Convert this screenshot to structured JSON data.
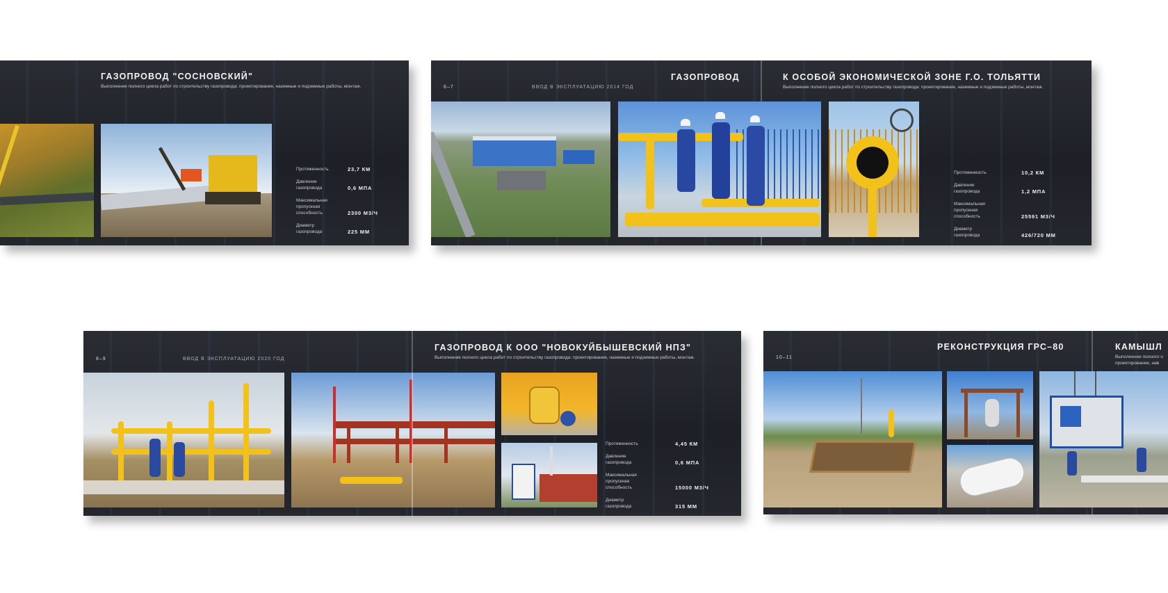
{
  "spreads": {
    "sosnovsky": {
      "title": "ГАЗОПРОВОД \"СОСНОВСКИЙ\"",
      "description": "Выполнение полного цикла работ по строительству газопровода: проектирование, наземные и подземные работы, монтаж.",
      "stats": [
        {
          "label": "Протяженность",
          "value": "23,7 КМ"
        },
        {
          "label": "Давление газопровода",
          "value": "0,6 МПА"
        },
        {
          "label": "Максимальная пропускная способность",
          "value": "2300 М3/Ч"
        },
        {
          "label": "Диаметр газопровода",
          "value": "225 ММ"
        }
      ]
    },
    "tolyatti": {
      "page": "6–7",
      "year": "ВВОД В ЭКСПЛУАТАЦИЮ 2014 ГОД",
      "title_left": "ГАЗОПРОВОД",
      "title_right": "К ОСОБОЙ ЭКОНОМИЧЕСКОЙ ЗОНЕ Г.О. ТОЛЬЯТТИ",
      "description": "Выполнение полного цикла работ по строительству газопровода: проектирование, наземные и подземные работы, монтаж.",
      "stats": [
        {
          "label": "Протяженность",
          "value": "10,2 КМ"
        },
        {
          "label": "Давление газопровода",
          "value": "1,2 МПА"
        },
        {
          "label": "Максимальная пропускная способность",
          "value": "25591 М3/Ч"
        },
        {
          "label": "Диаметр газопровода",
          "value": "426/720 ММ"
        }
      ]
    },
    "novokuibyshevsk": {
      "page": "8–9",
      "year": "ВВОД В ЭКСПЛУАТАЦИЮ 2020 ГОД",
      "title": "ГАЗОПРОВОД К ООО \"НОВОКУЙБЫШЕВСКИЙ НПЗ\"",
      "description": "Выполнение полного цикла работ по строительству газопровода: проектирование, наземные и подземные работы, монтаж.",
      "stats": [
        {
          "label": "Протяженность",
          "value": "4,45 КМ"
        },
        {
          "label": "Давление газопровода",
          "value": "0,6 МПА"
        },
        {
          "label": "Максимальная пропускная способность",
          "value": "15000 М3/Ч"
        },
        {
          "label": "Диаметр газопровода",
          "value": "315 ММ"
        }
      ]
    },
    "grs80": {
      "page": "10–11",
      "title": "РЕКОНСТРУКЦИЯ ГРС–80",
      "title_cut": "КАМЫШЛ",
      "description_cut": "Выполнение полного о",
      "description_cut2": "проектирование, нав"
    }
  },
  "colors": {
    "page_bg": "#ffffff",
    "spread_bg": "#22252b",
    "accent_yellow": "#f2c21b",
    "text": "#f2f2f2"
  }
}
